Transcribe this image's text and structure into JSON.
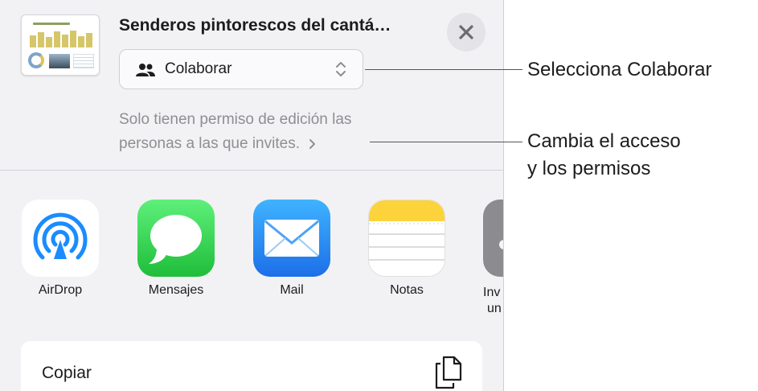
{
  "share_sheet": {
    "document_title": "Senderos pintorescos del cantá…",
    "collaboration_mode": "Colaborar",
    "access_line1": "Solo tienen permiso de edición las",
    "access_line2": "personas a las que invites.",
    "apps": [
      {
        "label": "AirDrop",
        "icon": "airdrop-icon"
      },
      {
        "label": "Mensajes",
        "icon": "messages-icon"
      },
      {
        "label": "Mail",
        "icon": "mail-icon"
      },
      {
        "label": "Notas",
        "icon": "notes-icon"
      },
      {
        "label_line1": "Inv",
        "label_line2": "un",
        "icon": "more-app-icon"
      }
    ],
    "actions": [
      {
        "label": "Copiar",
        "icon": "copy-icon"
      }
    ]
  },
  "callouts": {
    "collaborate": "Selecciona Colaborar",
    "access_line1": "Cambia el acceso",
    "access_line2": "y los permisos"
  },
  "colors": {
    "sheet_background": "#f2f2f4",
    "airdrop_blue": "#1a8cff",
    "messages_green": "#2ccb47",
    "mail_blue": "#2589f5",
    "notes_yellow": "#fcd33b"
  }
}
